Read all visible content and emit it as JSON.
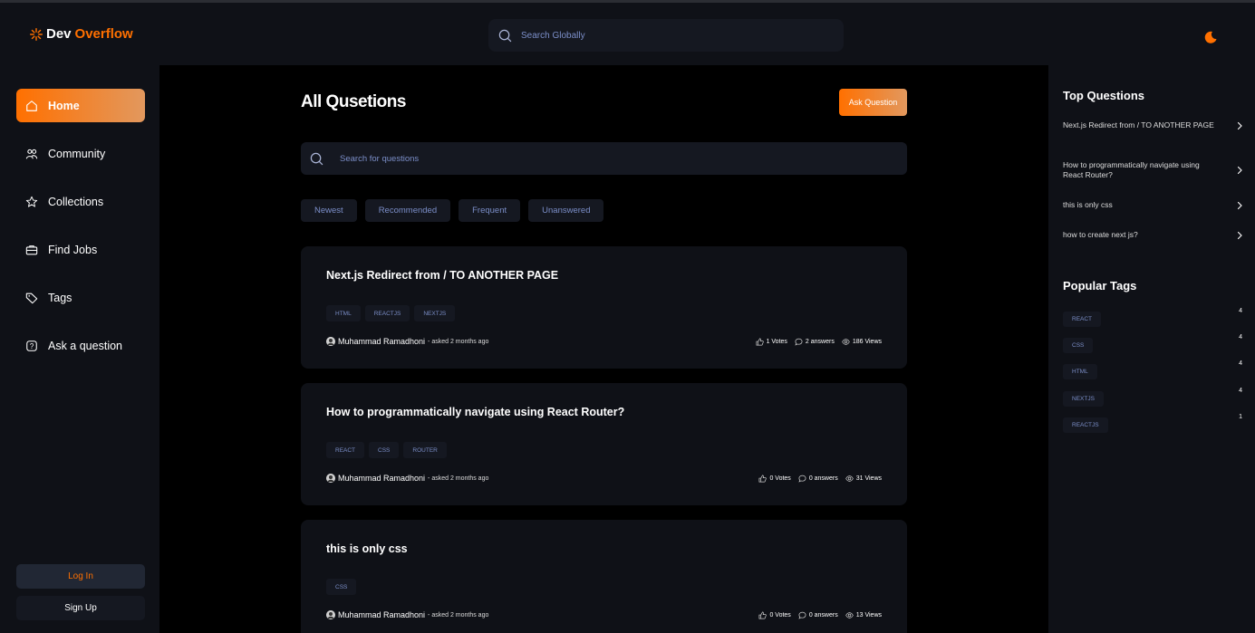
{
  "header": {
    "logo_dev": "Dev",
    "logo_overflow": "Overflow",
    "search_placeholder": "Search Globally"
  },
  "sidebar": {
    "items": [
      {
        "label": "Home",
        "icon": "home-icon",
        "active": true
      },
      {
        "label": "Community",
        "icon": "users-icon"
      },
      {
        "label": "Collections",
        "icon": "star-icon"
      },
      {
        "label": "Find Jobs",
        "icon": "suitcase-icon"
      },
      {
        "label": "Tags",
        "icon": "tag-icon"
      },
      {
        "label": "Ask a question",
        "icon": "question-icon"
      }
    ],
    "login_label": "Log In",
    "signup_label": "Sign Up"
  },
  "main": {
    "title": "All Qusetions",
    "ask_button": "Ask Question",
    "search_placeholder": "Search for questions",
    "filters": [
      "Newest",
      "Recommended",
      "Frequent",
      "Unanswered"
    ],
    "questions": [
      {
        "title": "Next.js Redirect from / TO ANOTHER PAGE",
        "tags": [
          "HTML",
          "REACTJS",
          "NEXTJS"
        ],
        "author": "Muhammad Ramadhoni",
        "asked": "- asked 2 months ago",
        "votes": "1 Votes",
        "answers": "2 answers",
        "views": "186 Views"
      },
      {
        "title": "How to programmatically navigate using React Router?",
        "tags": [
          "REACT",
          "CSS",
          "ROUTER"
        ],
        "author": "Muhammad Ramadhoni",
        "asked": "- asked 2 months ago",
        "votes": "0 Votes",
        "answers": "0 answers",
        "views": "31 Views"
      },
      {
        "title": "this is only css",
        "tags": [
          "CSS"
        ],
        "author": "Muhammad Ramadhoni",
        "asked": "- asked 2 months ago",
        "votes": "0 Votes",
        "answers": "0 answers",
        "views": "13 Views"
      }
    ]
  },
  "rightbar": {
    "top_questions_title": "Top Questions",
    "top_questions": [
      "Next.js Redirect from / TO ANOTHER PAGE",
      "How to programmatically navigate using React Router?",
      "this is only css",
      "how to create next js?"
    ],
    "popular_tags_title": "Popular Tags",
    "popular_tags": [
      {
        "name": "REACT",
        "count": "4"
      },
      {
        "name": "CSS",
        "count": "4"
      },
      {
        "name": "HTML",
        "count": "4"
      },
      {
        "name": "NEXTJS",
        "count": "4"
      },
      {
        "name": "REACTJS",
        "count": "1"
      }
    ]
  },
  "colors": {
    "accent": "#ff7000",
    "accent_light": "#e2985e",
    "panel": "#0f1117",
    "field": "#151821",
    "muted_text": "#7b8ec8"
  }
}
